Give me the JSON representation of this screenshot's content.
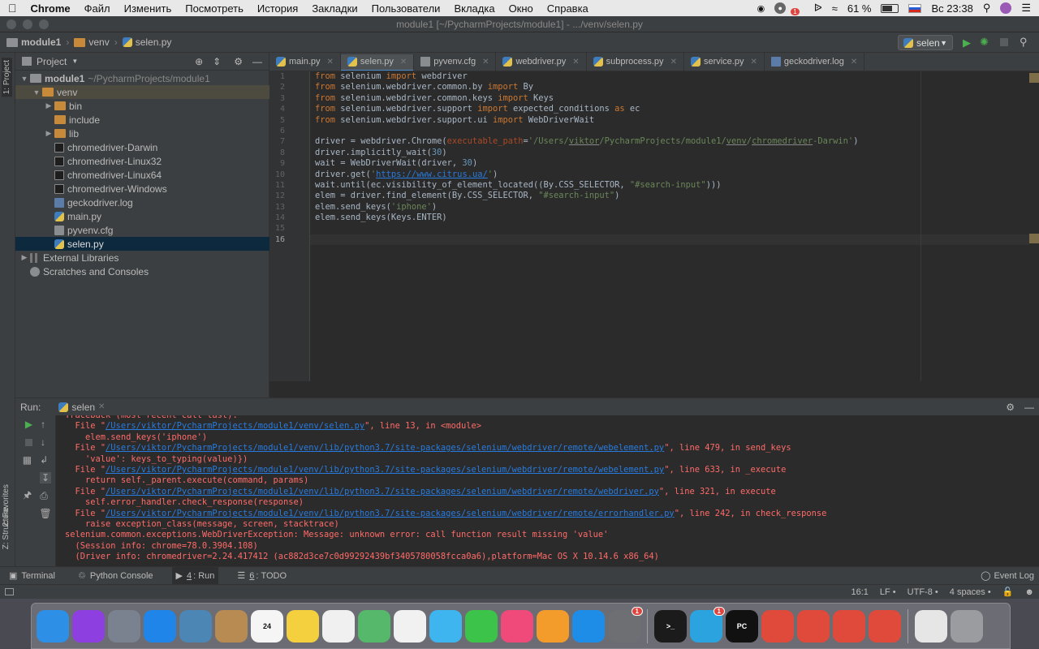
{
  "menubar": {
    "app": "Chrome",
    "items": [
      "Файл",
      "Изменить",
      "Посмотреть",
      "История",
      "Закладки",
      "Пользователи",
      "Вкладка",
      "Окно",
      "Справка"
    ],
    "battery": "61 %",
    "clock": "Вс 23:38",
    "notif_count": "1"
  },
  "window": {
    "title": "module1 [~/PycharmProjects/module1] - .../venv/selen.py"
  },
  "navbar": {
    "crumbs": [
      "module1",
      "venv",
      "selen.py"
    ],
    "run_config": "selen"
  },
  "stripe": {
    "project": "1: Project",
    "favorites": "2: Favorites",
    "structure": "Z: Structure"
  },
  "project": {
    "header": "Project",
    "root": {
      "name": "module1",
      "path": "~/PycharmProjects/module1"
    },
    "venv": "venv",
    "folders": [
      "bin",
      "include",
      "lib"
    ],
    "files": [
      {
        "name": "chromedriver-Darwin",
        "kind": "exe"
      },
      {
        "name": "chromedriver-Linux32",
        "kind": "exe"
      },
      {
        "name": "chromedriver-Linux64",
        "kind": "exe"
      },
      {
        "name": "chromedriver-Windows",
        "kind": "exe"
      },
      {
        "name": "geckodriver.log",
        "kind": "log"
      },
      {
        "name": "main.py",
        "kind": "py"
      },
      {
        "name": "pyvenv.cfg",
        "kind": "cfg"
      },
      {
        "name": "selen.py",
        "kind": "py",
        "selected": true
      }
    ],
    "external": "External Libraries",
    "scratches": "Scratches and Consoles"
  },
  "tabs": [
    {
      "label": "main.py",
      "kind": "py"
    },
    {
      "label": "selen.py",
      "kind": "py",
      "active": true
    },
    {
      "label": "pyvenv.cfg",
      "kind": "cfg"
    },
    {
      "label": "webdriver.py",
      "kind": "py"
    },
    {
      "label": "subprocess.py",
      "kind": "py"
    },
    {
      "label": "service.py",
      "kind": "py"
    },
    {
      "label": "geckodriver.log",
      "kind": "log"
    }
  ],
  "code": [
    [
      [
        "kw",
        "from"
      ],
      [
        "t",
        " selenium "
      ],
      [
        "kw",
        "import"
      ],
      [
        "t",
        " webdriver"
      ]
    ],
    [
      [
        "kw",
        "from"
      ],
      [
        "t",
        " selenium.webdriver.common.by "
      ],
      [
        "kw",
        "import"
      ],
      [
        "t",
        " By"
      ]
    ],
    [
      [
        "kw",
        "from"
      ],
      [
        "t",
        " selenium.webdriver.common.keys "
      ],
      [
        "kw",
        "import"
      ],
      [
        "t",
        " Keys"
      ]
    ],
    [
      [
        "kw",
        "from"
      ],
      [
        "t",
        " selenium.webdriver.support "
      ],
      [
        "kw",
        "import"
      ],
      [
        "t",
        " expected_conditions "
      ],
      [
        "kw",
        "as"
      ],
      [
        "t",
        " ec"
      ]
    ],
    [
      [
        "kw",
        "from"
      ],
      [
        "t",
        " selenium.webdriver.support.ui "
      ],
      [
        "kw",
        "import"
      ],
      [
        "t",
        " WebDriverWait"
      ]
    ],
    [],
    [
      [
        "t",
        "driver = webdriver.Chrome("
      ],
      [
        "prm",
        "executable_path"
      ],
      [
        "t",
        "="
      ],
      [
        "sp",
        "'/Users/"
      ],
      [
        "spw",
        "viktor"
      ],
      [
        "sp",
        "/PycharmProjects/module1/"
      ],
      [
        "spw",
        "venv"
      ],
      [
        "sp",
        "/"
      ],
      [
        "spw",
        "chromedriver"
      ],
      [
        "sp",
        "-Darwin'"
      ],
      [
        "t",
        ")"
      ]
    ],
    [
      [
        "t",
        "driver.implicitly_wait("
      ],
      [
        "num",
        "30"
      ],
      [
        "t",
        ")"
      ]
    ],
    [
      [
        "t",
        "wait = WebDriverWait(driver, "
      ],
      [
        "num",
        "30"
      ],
      [
        "t",
        ")"
      ]
    ],
    [
      [
        "t",
        "driver.get("
      ],
      [
        "sp",
        "'"
      ],
      [
        "lnk",
        "https://www.citrus.ua/"
      ],
      [
        "sp",
        "'"
      ],
      [
        "t",
        ")"
      ]
    ],
    [
      [
        "t",
        "wait.until(ec.visibility_of_element_located((By.CSS_SELECTOR, "
      ],
      [
        "sp",
        "\"#search-input\""
      ],
      [
        "t",
        ")))"
      ]
    ],
    [
      [
        "t",
        "elem = driver.find_element(By.CSS_SELECTOR, "
      ],
      [
        "sp",
        "\"#search-input\""
      ],
      [
        "t",
        ")"
      ]
    ],
    [
      [
        "t",
        "elem.send_keys("
      ],
      [
        "sp",
        "'iphone'"
      ],
      [
        "t",
        ")"
      ]
    ],
    [
      [
        "t",
        "elem.send_keys(Keys.ENTER)"
      ]
    ],
    [],
    []
  ],
  "current_line": 16,
  "run": {
    "label": "Run:",
    "config": "selen",
    "output": [
      [
        [
          "t",
          "Traceback (most recent call last):"
        ]
      ],
      [
        [
          "t",
          "  File \""
        ],
        [
          "lnk",
          "/Users/viktor/PycharmProjects/module1/venv/selen.py"
        ],
        [
          "t",
          "\", line 13, in <module>"
        ]
      ],
      [
        [
          "t",
          "    elem.send_keys('iphone')"
        ]
      ],
      [
        [
          "t",
          "  File \""
        ],
        [
          "lnk",
          "/Users/viktor/PycharmProjects/module1/venv/lib/python3.7/site-packages/selenium/webdriver/remote/webelement.py"
        ],
        [
          "t",
          "\", line 479, in send_keys"
        ]
      ],
      [
        [
          "t",
          "    'value': keys_to_typing(value)})"
        ]
      ],
      [
        [
          "t",
          "  File \""
        ],
        [
          "lnk",
          "/Users/viktor/PycharmProjects/module1/venv/lib/python3.7/site-packages/selenium/webdriver/remote/webelement.py"
        ],
        [
          "t",
          "\", line 633, in _execute"
        ]
      ],
      [
        [
          "t",
          "    return self._parent.execute(command, params)"
        ]
      ],
      [
        [
          "t",
          "  File \""
        ],
        [
          "lnk",
          "/Users/viktor/PycharmProjects/module1/venv/lib/python3.7/site-packages/selenium/webdriver/remote/webdriver.py"
        ],
        [
          "t",
          "\", line 321, in execute"
        ]
      ],
      [
        [
          "t",
          "    self.error_handler.check_response(response)"
        ]
      ],
      [
        [
          "t",
          "  File \""
        ],
        [
          "lnk",
          "/Users/viktor/PycharmProjects/module1/venv/lib/python3.7/site-packages/selenium/webdriver/remote/errorhandler.py"
        ],
        [
          "t",
          "\", line 242, in check_response"
        ]
      ],
      [
        [
          "t",
          "    raise exception_class(message, screen, stacktrace)"
        ]
      ],
      [
        [
          "t",
          "selenium.common.exceptions.WebDriverException: Message: unknown error: call function result missing 'value'"
        ]
      ],
      [
        [
          "t",
          "  (Session info: chrome=78.0.3904.108)"
        ]
      ],
      [
        [
          "t",
          "  (Driver info: chromedriver=2.24.417412 (ac882d3ce7c0d99292439bf3405780058fcca0a6),platform=Mac OS X 10.14.6 x86_64)"
        ]
      ]
    ]
  },
  "toolwindows": [
    {
      "label": "Terminal"
    },
    {
      "label": "Python Console"
    },
    {
      "num": "4",
      "label": "Run",
      "active": true
    },
    {
      "num": "6",
      "label": "TODO"
    }
  ],
  "event_log": "Event Log",
  "status": {
    "pos": "16:1",
    "lf": "LF",
    "enc": "UTF-8",
    "indent": "4 spaces"
  },
  "dock": [
    {
      "name": "finder",
      "label": "",
      "color": "#2d8fe6"
    },
    {
      "name": "siri",
      "label": "",
      "color": "#8d3fe0"
    },
    {
      "name": "launchpad",
      "label": "",
      "color": "#7a8290"
    },
    {
      "name": "safari",
      "label": "",
      "color": "#1f85e8"
    },
    {
      "name": "preview",
      "label": "",
      "color": "#4b86b4"
    },
    {
      "name": "contacts",
      "label": "",
      "color": "#b88b52"
    },
    {
      "name": "calendar",
      "label": "24",
      "color": "#f5f5f5",
      "text": "#111"
    },
    {
      "name": "notes",
      "label": "",
      "color": "#f4d03f"
    },
    {
      "name": "reminders",
      "label": "",
      "color": "#f0f0f0"
    },
    {
      "name": "maps",
      "label": "",
      "color": "#55b86a"
    },
    {
      "name": "photos",
      "label": "",
      "color": "#f1f1f1"
    },
    {
      "name": "messages",
      "label": "",
      "color": "#3fb5f0"
    },
    {
      "name": "facetime",
      "label": "",
      "color": "#3cc44a"
    },
    {
      "name": "itunes",
      "label": "",
      "color": "#f04a7a"
    },
    {
      "name": "books",
      "label": "",
      "color": "#f39c2c"
    },
    {
      "name": "app-store",
      "label": "",
      "color": "#1e8de8"
    },
    {
      "name": "system-preferences",
      "label": "",
      "color": "#6d6f73",
      "badge": "1"
    },
    {
      "divider": true
    },
    {
      "name": "terminal",
      "label": ">_",
      "color": "#1b1b1b"
    },
    {
      "name": "telegram",
      "label": "",
      "color": "#2aa3de",
      "badge": "1"
    },
    {
      "name": "pycharm",
      "label": "PC",
      "color": "#111",
      "text": "#fff"
    },
    {
      "name": "chrome-1",
      "label": "",
      "color": "#e04a3b"
    },
    {
      "name": "chrome-2",
      "label": "",
      "color": "#e04a3b"
    },
    {
      "name": "chrome-3",
      "label": "",
      "color": "#e04a3b"
    },
    {
      "name": "chrome-4",
      "label": "",
      "color": "#e04a3b"
    },
    {
      "divider": true
    },
    {
      "name": "downloads",
      "label": "",
      "color": "#e6e6e6"
    },
    {
      "name": "trash",
      "label": "",
      "color": "#9a9ca0"
    }
  ]
}
